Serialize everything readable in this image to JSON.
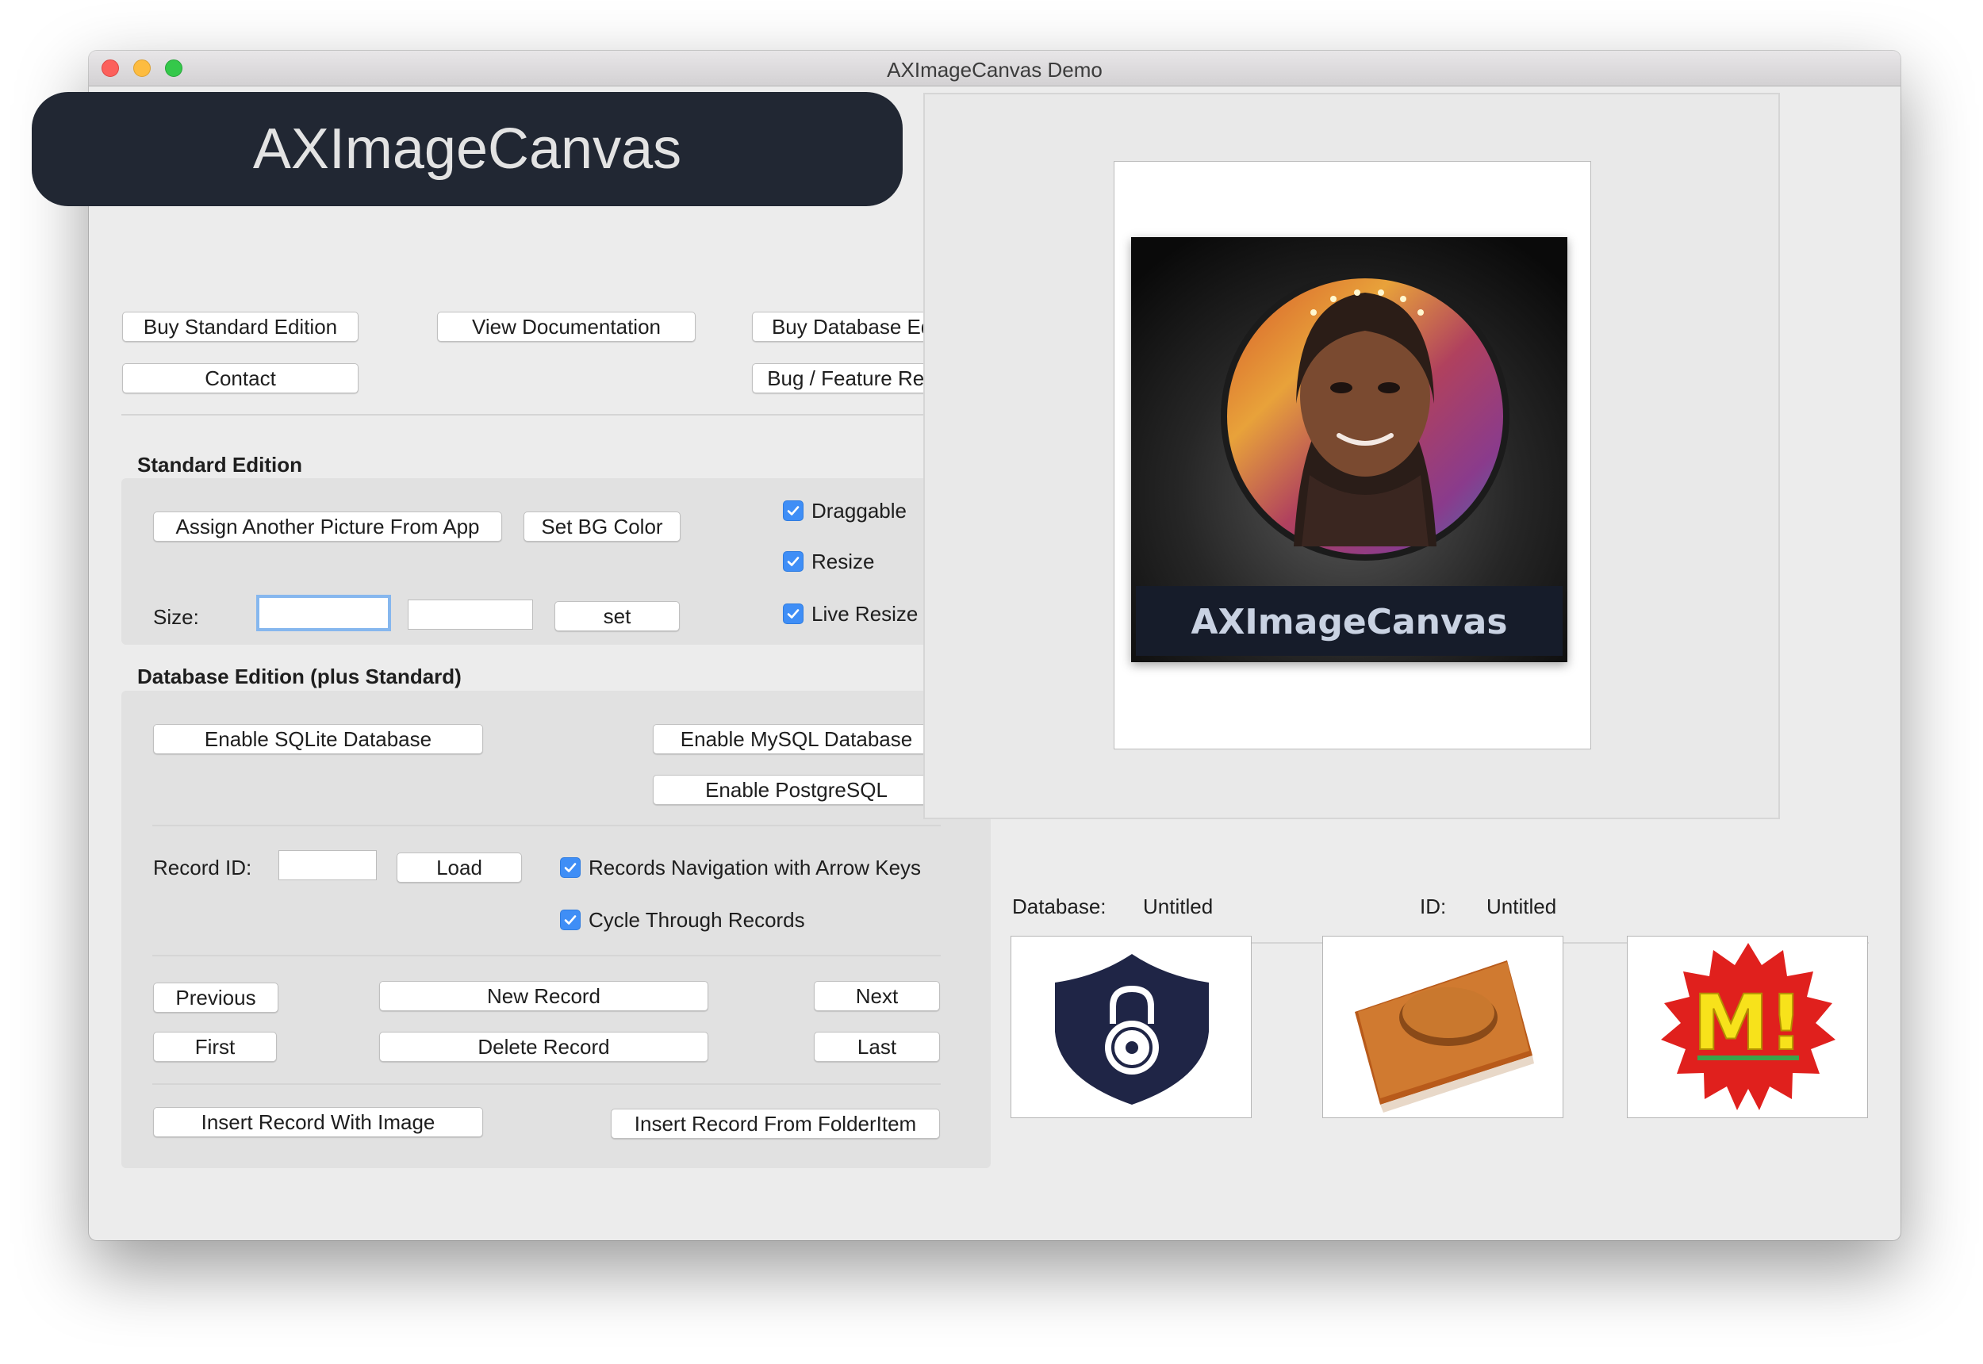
{
  "window": {
    "title": "AXImageCanvas Demo"
  },
  "banner": {
    "text": "AXImageCanvas"
  },
  "top_buttons": {
    "buy_standard": "Buy Standard Edition",
    "view_docs": "View Documentation",
    "buy_database": "Buy Database Edition",
    "contact": "Contact",
    "bug_request": "Bug / Feature Request"
  },
  "standard": {
    "title": "Standard Edition",
    "assign_picture": "Assign Another Picture From App",
    "set_bg_color": "Set BG Color",
    "size_label": "Size:",
    "width_value": "",
    "height_value": "",
    "set_button": "set",
    "checkboxes": {
      "draggable": {
        "label": "Draggable",
        "checked": true
      },
      "resize": {
        "label": "Resize",
        "checked": true
      },
      "live_resize": {
        "label": "Live Resize",
        "checked": true
      }
    }
  },
  "database": {
    "title": "Database Edition (plus Standard)",
    "enable_sqlite": "Enable SQLite Database",
    "enable_mysql": "Enable MySQL Database",
    "enable_postgres": "Enable PostgreSQL",
    "record_id_label": "Record ID:",
    "record_id_value": "",
    "load_button": "Load",
    "checkboxes": {
      "arrow_nav": {
        "label": "Records Navigation with Arrow Keys",
        "checked": true
      },
      "cycle": {
        "label": "Cycle Through Records",
        "checked": true
      }
    },
    "nav": {
      "previous": "Previous",
      "new_record": "New Record",
      "next": "Next",
      "first": "First",
      "delete_record": "Delete Record",
      "last": "Last"
    },
    "insert_with_image": "Insert Record With Image",
    "insert_from_folderitem": "Insert Record From FolderItem"
  },
  "preview": {
    "caption": "AXImageCanvas",
    "database_label": "Database:",
    "database_value": "Untitled",
    "id_label": "ID:",
    "id_value": "Untitled"
  },
  "thumbnails": {
    "t1": {
      "icon": "security-lock-icon"
    },
    "t2": {
      "icon": "button-tile-icon"
    },
    "t3": {
      "icon": "starburst-badge-icon",
      "text": "M!"
    }
  },
  "colors": {
    "accent": "#3f8ef6",
    "banner_bg": "#212733",
    "window_bg": "#ececec"
  }
}
